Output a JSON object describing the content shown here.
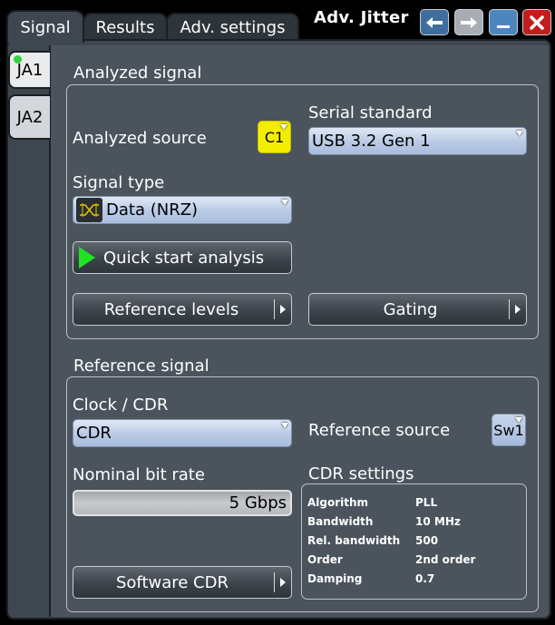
{
  "tabs": [
    {
      "label": "Signal",
      "active": true
    },
    {
      "label": "Results",
      "active": false
    },
    {
      "label": "Adv. settings",
      "active": false
    }
  ],
  "window": {
    "title": "Adv. Jitter",
    "buttons": [
      {
        "icon": "arrow-left-icon",
        "color": "#3f6e9c"
      },
      {
        "icon": "arrow-right-icon",
        "color": "#a7adb3"
      },
      {
        "icon": "minimize-icon",
        "color": "#4d85bd"
      },
      {
        "icon": "close-icon",
        "color": "#c21d1d"
      }
    ]
  },
  "side_tabs": [
    {
      "label": "JA1",
      "active": true,
      "indicator_color": "#2fd33c"
    },
    {
      "label": "JA2",
      "active": false
    }
  ],
  "analyzed_signal": {
    "title": "Analyzed signal",
    "source_label": "Analyzed source",
    "source_value": "C1",
    "source_color": "#f3ee00",
    "serial_standard_label": "Serial standard",
    "serial_standard_value": "USB 3.2 Gen 1",
    "signal_type_label": "Signal type",
    "signal_type_value": "Data (NRZ)",
    "signal_type_icon": "eye-diagram-icon",
    "quick_start_label": "Quick start analysis",
    "reference_levels_label": "Reference levels",
    "gating_label": "Gating"
  },
  "reference_signal": {
    "title": "Reference signal",
    "clock_cdr_label": "Clock / CDR",
    "clock_cdr_value": "CDR",
    "reference_source_label": "Reference source",
    "reference_source_value": "Sw1",
    "nominal_bit_rate_label": "Nominal bit rate",
    "nominal_bit_rate_value": "5 Gbps",
    "software_cdr_label": "Software CDR",
    "cdr_settings": {
      "title": "CDR settings",
      "rows": [
        {
          "key": "Algorithm",
          "value": "PLL"
        },
        {
          "key": "Bandwidth",
          "value": "10 MHz"
        },
        {
          "key": "Rel. bandwidth",
          "value": "500"
        },
        {
          "key": "Order",
          "value": "2nd order"
        },
        {
          "key": "Damping",
          "value": "0.7"
        }
      ]
    }
  }
}
